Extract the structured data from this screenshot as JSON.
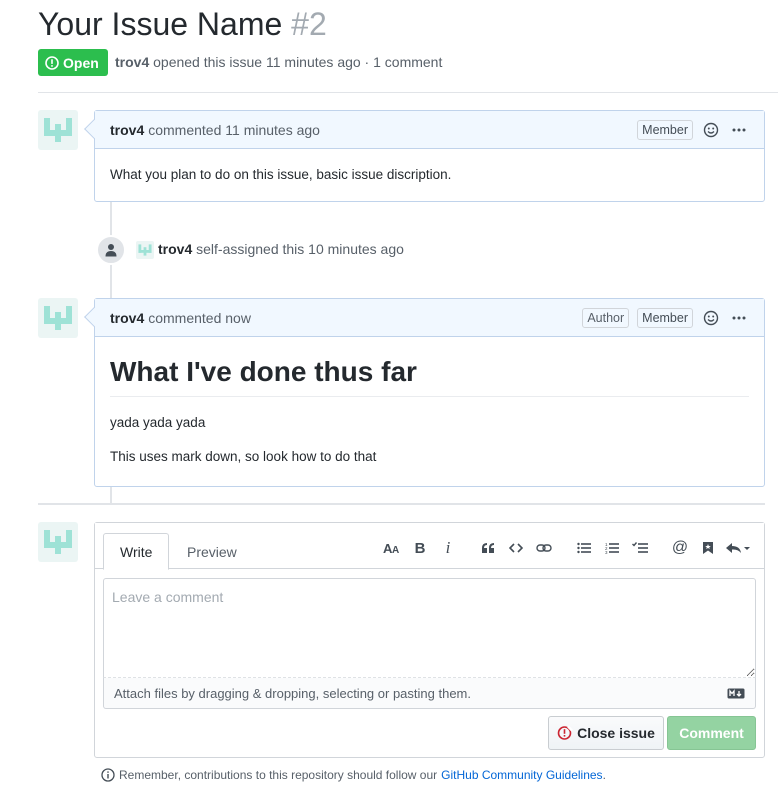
{
  "issue": {
    "title": "Your Issue Name",
    "number": "#2",
    "state": "Open",
    "author": "trov4",
    "opened_text": "opened this issue 11 minutes ago · 1 comment"
  },
  "comments": [
    {
      "author": "trov4",
      "time_text": "commented 11 minutes ago",
      "badges": [
        "Member"
      ],
      "body": "What you plan to do on this issue, basic issue discription."
    },
    {
      "author": "trov4",
      "time_text": "commented now",
      "badges": [
        "Author",
        "Member"
      ],
      "heading": "What I've done thus far",
      "paragraphs": [
        "yada yada yada",
        "This uses mark down, so look how to do that"
      ]
    }
  ],
  "event": {
    "actor": "trov4",
    "text": "self-assigned this 10 minutes ago"
  },
  "composer": {
    "tab_write": "Write",
    "tab_preview": "Preview",
    "placeholder": "Leave a comment",
    "attach_text": "Attach files by dragging & dropping, selecting or pasting them.",
    "close_label": "Close issue",
    "comment_label": "Comment"
  },
  "footer": {
    "text": "Remember, contributions to this repository should follow our",
    "link": "GitHub Community Guidelines",
    "tail": "."
  },
  "colors": {
    "open_green": "#2cbe4e",
    "comment_btn": "#94d3a2",
    "comment_header_bg": "#f1f8ff",
    "link": "#0366d6",
    "avatar_teal": "#9ee2d6"
  }
}
